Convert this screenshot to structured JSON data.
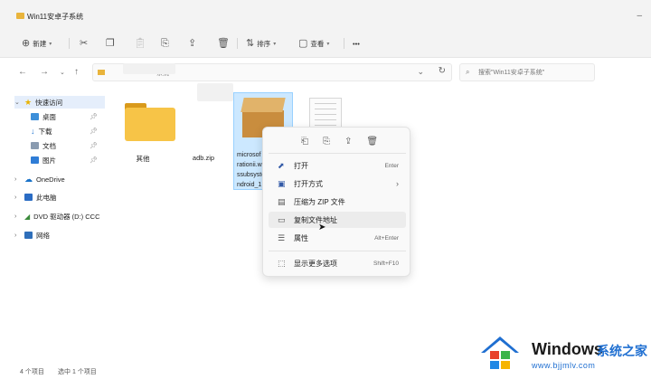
{
  "window": {
    "title": "Win11安卓子系统"
  },
  "toolbar": {
    "new_label": "新建",
    "sort_label": "排序",
    "view_label": "查看",
    "more_label": "•••"
  },
  "address": {
    "breadcrumb": "系统",
    "search_placeholder": "搜索\"Win11安卓子系统\""
  },
  "sidebar": {
    "quick_access": "快速访问",
    "items": [
      {
        "label": "桌面"
      },
      {
        "label": "下载"
      },
      {
        "label": "文档"
      },
      {
        "label": "图片"
      }
    ],
    "onedrive": "OneDrive",
    "this_pc": "此电脑",
    "dvd": "DVD 驱动器 (D:) CCC",
    "network": "网络"
  },
  "files": [
    {
      "label": "其他"
    },
    {
      "label": "adb.zip"
    },
    {
      "label_lines": [
        "microsof",
        "rationii.w",
        "ssubsyste",
        "ndroid_1"
      ]
    }
  ],
  "context_menu": {
    "items": [
      {
        "label": "打开",
        "shortcut": "Enter"
      },
      {
        "label": "打开方式",
        "shortcut": "›"
      },
      {
        "label": "压缩为 ZIP 文件",
        "shortcut": ""
      },
      {
        "label": "复制文件地址",
        "shortcut": ""
      },
      {
        "label": "属性",
        "shortcut": "Alt+Enter"
      },
      {
        "label": "显示更多选项",
        "shortcut": "Shift+F10"
      }
    ]
  },
  "status": {
    "count": "4 个项目",
    "selected": "选中 1 个项目"
  },
  "watermark": {
    "brand": "Windows",
    "suffix": "系统之家",
    "url": "www.bjjmlv.com"
  },
  "colors": {
    "folder": "#f7c447",
    "selection": "#cce8ff",
    "accent": "#1f6fd1"
  }
}
